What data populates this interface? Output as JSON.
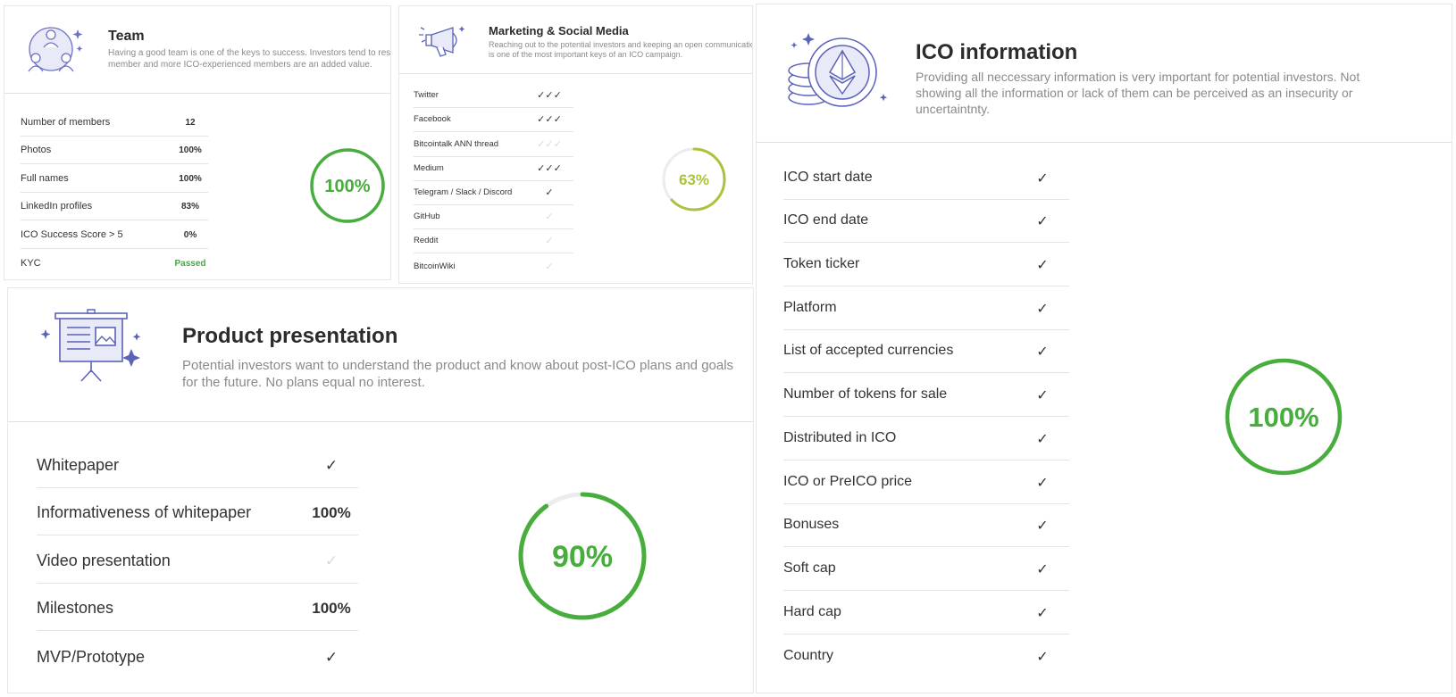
{
  "colors": {
    "accent_green": "#47ad3c",
    "partial_green": "#a9c43c",
    "check_off": "#d9d9d9",
    "icon_purple": "#5b63b8"
  },
  "team": {
    "icon": "team-icon",
    "title": "Team",
    "description_line1": "Having a good team is one of the keys to success. Investors tend to research each",
    "description_line2": "member and more ICO-experienced members are an added value.",
    "rows": [
      {
        "label": "Number of members",
        "value": "12"
      },
      {
        "label": "Photos",
        "value": "100%"
      },
      {
        "label": "Full names",
        "value": "100%"
      },
      {
        "label": "LinkedIn profiles",
        "value": "83%"
      },
      {
        "label": "ICO Success Score > 5",
        "value": "0%"
      },
      {
        "label": "KYC",
        "value": "Passed"
      }
    ],
    "score_text": "100%",
    "score": 100
  },
  "marketing": {
    "icon": "megaphone-icon",
    "title": "Marketing & Social Media",
    "description_line1": "Reaching out to the potential investors and keeping an open communication with them",
    "description_line2": "is one of the most important keys of an ICO campaign.",
    "rows": [
      {
        "label": "Twitter",
        "value": "✓✓✓",
        "checks": [
          true,
          true,
          true
        ]
      },
      {
        "label": "Facebook",
        "value": "✓✓✓",
        "checks": [
          true,
          true,
          true
        ]
      },
      {
        "label": "Bitcointalk ANN thread",
        "value": "✓✓✓",
        "checks": [
          false,
          false,
          false
        ]
      },
      {
        "label": "Medium",
        "value": "✓✓✓",
        "checks": [
          true,
          true,
          true
        ]
      },
      {
        "label": "Telegram / Slack / Discord",
        "value": "✓",
        "checks": [
          true
        ]
      },
      {
        "label": "GitHub",
        "value": "✓",
        "checks": [
          false
        ]
      },
      {
        "label": "Reddit",
        "value": "✓",
        "checks": [
          false
        ]
      },
      {
        "label": "BitcoinWiki",
        "value": "✓",
        "checks": [
          false
        ]
      }
    ],
    "score_text": "63%",
    "score": 63
  },
  "product": {
    "icon": "presentation-board-icon",
    "title": "Product presentation",
    "description": "Potential investors want to understand the product and know about post-ICO plans and goals for the future. No plans equal no interest.",
    "rows": [
      {
        "label": "Whitepaper",
        "value": "✓",
        "check": true
      },
      {
        "label": "Informativeness of whitepaper",
        "value": "100%"
      },
      {
        "label": "Video presentation",
        "value": "✓",
        "check": false
      },
      {
        "label": "Milestones",
        "value": "100%"
      },
      {
        "label": "MVP/Prototype",
        "value": "✓",
        "check": true
      }
    ],
    "score_text": "90%",
    "score": 90
  },
  "ico": {
    "icon": "ethereum-coins-icon",
    "title": "ICO information",
    "description": "Providing all neccessary information is very important for potential investors. Not showing all the information or lack of them can be perceived as an insecurity or uncertaintnty.",
    "rows": [
      {
        "label": "ICO start date",
        "value": "✓"
      },
      {
        "label": "ICO end date",
        "value": "✓"
      },
      {
        "label": "Token ticker",
        "value": "✓"
      },
      {
        "label": "Platform",
        "value": "✓"
      },
      {
        "label": "List of accepted currencies",
        "value": "✓"
      },
      {
        "label": "Number of tokens for sale",
        "value": "✓"
      },
      {
        "label": "Distributed in ICO",
        "value": "✓"
      },
      {
        "label": "ICO or PreICO price",
        "value": "✓"
      },
      {
        "label": "Bonuses",
        "value": "✓"
      },
      {
        "label": "Soft cap",
        "value": "✓"
      },
      {
        "label": "Hard cap",
        "value": "✓"
      },
      {
        "label": "Country",
        "value": "✓"
      }
    ],
    "score_text": "100%",
    "score": 100
  }
}
